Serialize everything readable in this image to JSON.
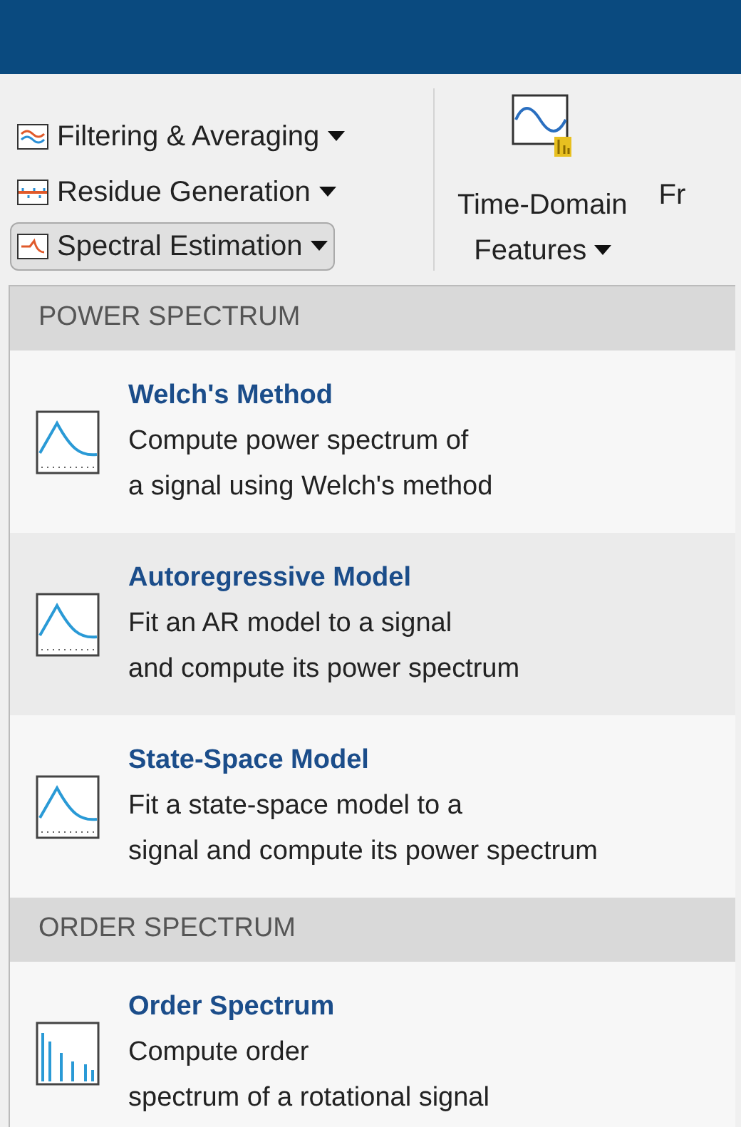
{
  "toolbar": {
    "buttons": [
      {
        "label": "Filtering & Averaging",
        "kind": "filter",
        "selected": false
      },
      {
        "label": "Residue Generation",
        "kind": "residue",
        "selected": false
      },
      {
        "label": "Spectral Estimation",
        "kind": "spectral",
        "selected": true
      }
    ],
    "big_button": {
      "line1": "Time-Domain",
      "line2": "Features"
    },
    "cut_label": "Fr"
  },
  "menu": {
    "sections": [
      {
        "header": "POWER SPECTRUM",
        "items": [
          {
            "title": "Welch's Method",
            "lines": [
              "Compute power spectrum of",
              "a signal using Welch's method"
            ],
            "kind": "curve",
            "selected": false
          },
          {
            "title": "Autoregressive Model",
            "lines": [
              "Fit an AR model to a signal",
              "and compute its power spectrum"
            ],
            "kind": "curve",
            "selected": true
          },
          {
            "title": "State-Space Model",
            "lines": [
              "Fit a state-space model to a",
              "signal and compute its power spectrum"
            ],
            "kind": "curve",
            "selected": false
          }
        ]
      },
      {
        "header": "ORDER SPECTRUM",
        "items": [
          {
            "title": "Order Spectrum",
            "lines": [
              "Compute order",
              "spectrum of a rotational signal"
            ],
            "kind": "bars",
            "selected": false
          }
        ]
      }
    ]
  }
}
